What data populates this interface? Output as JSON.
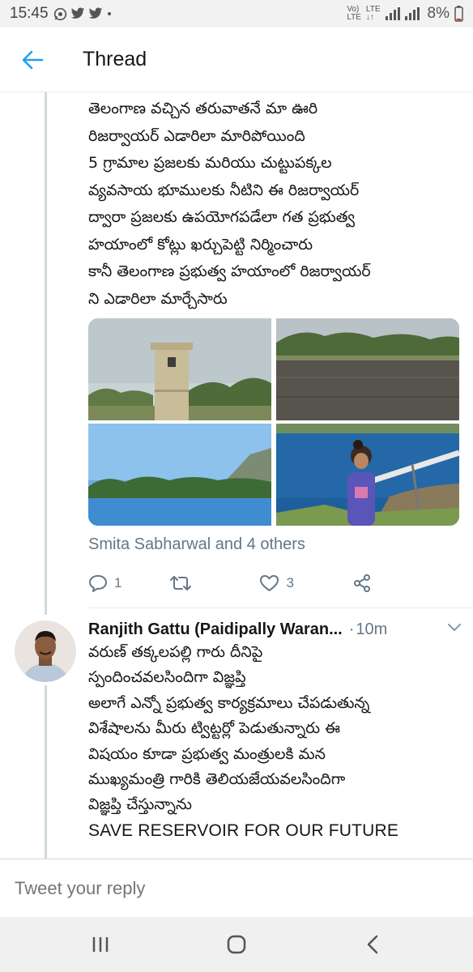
{
  "status_bar": {
    "time": "15:45",
    "network_label_1": "Vo)",
    "network_label_2": "LTE",
    "lte_label": "LTE",
    "battery": "8%",
    "icons": [
      "whatsapp-icon",
      "twitter-icon",
      "twitter-icon",
      "dot-icon",
      "signal-icon",
      "battery-icon"
    ]
  },
  "header": {
    "title": "Thread",
    "back_icon": "arrow-left-icon",
    "accent_color": "#1da1f2"
  },
  "tweet": {
    "lines": [
      "తెలంగాణ వచ్చిన తరువాతనే మా ఊరి",
      "రిజర్వాయర్ ఎడారిలా మారిపోయింది",
      "5 గ్రామాల ప్రజలకు మరియు చుట్టుపక్కల",
      "వ్యవసాయ భూములకు నీటిని ఈ రిజర్వాయర్",
      "ద్వారా ప్రజలకు ఉపయోగపడేలా గత ప్రభుత్వ",
      "హయాంలో కోట్లు ఖర్చుపెట్టి నిర్మించారు",
      "కానీ తెలంగాణ ప్రభుత్వ హయాంలో రిజర్వాయర్",
      "ని ఎడారిలా మార్చేసారు"
    ],
    "liked_by": "Smita Sabharwal and 4 others",
    "actions": {
      "reply_count": "1",
      "retweet_count": "",
      "like_count": "3"
    }
  },
  "reply": {
    "author": "Ranjith Gattu (Paidipally Waran...",
    "separator": "·",
    "time": "10m",
    "lines": [
      "వరుణ్ తక్కలపల్లి గారు దీనిపై",
      "స్పందించవలసిందిగా విజ్ఞప్తి",
      "అలాగే ఎన్నో ప్రభుత్వ కార్యక్రమాలు చేపడుతున్న",
      "విశేషాలను మీరు ట్విట్టర్లో పెడుతున్నారు ఈ",
      "విషయం కూడా ప్రభుత్వ మంత్రులకి మన",
      "ముఖ్యమంత్రి గారికి తెలియజేయవలసిందిగా",
      "విజ్ఞప్తి చేస్తున్నాను"
    ],
    "last_line": "SAVE RESERVOIR FOR OUR FUTURE"
  },
  "compose": {
    "placeholder": "Tweet your reply"
  },
  "nav": {
    "icons": [
      "recents-icon",
      "home-icon",
      "back-icon"
    ]
  }
}
